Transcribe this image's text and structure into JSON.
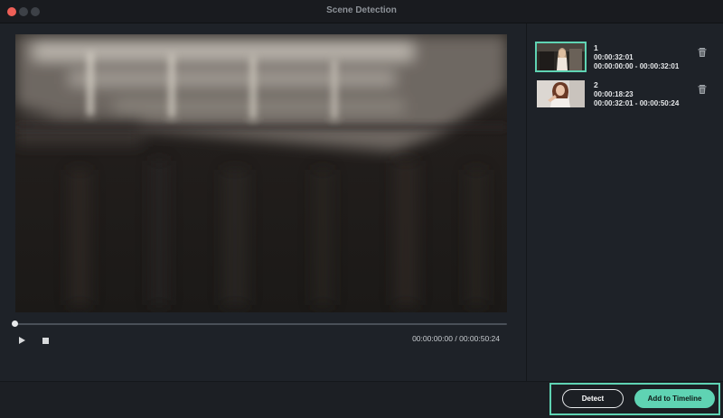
{
  "window": {
    "title": "Scene Detection"
  },
  "player": {
    "current_time": "00:00:00:00",
    "separator": "/",
    "total_time": "00:00:50:24",
    "progress_fraction": 0
  },
  "scenes": [
    {
      "index": "1",
      "duration": "00:00:32:01",
      "range": "00:00:00:00 - 00:00:32:01",
      "selected": true
    },
    {
      "index": "2",
      "duration": "00:00:18:23",
      "range": "00:00:32:01 - 00:00:50:24",
      "selected": false
    }
  ],
  "actions": {
    "detect_label": "Detect",
    "add_label": "Add to Timeline"
  },
  "colors": {
    "accent": "#5fd3b3",
    "background": "#1e2228",
    "close": "#ee5f57"
  },
  "icons": {
    "play": "play-icon",
    "stop": "stop-icon",
    "delete": "trash-icon"
  }
}
